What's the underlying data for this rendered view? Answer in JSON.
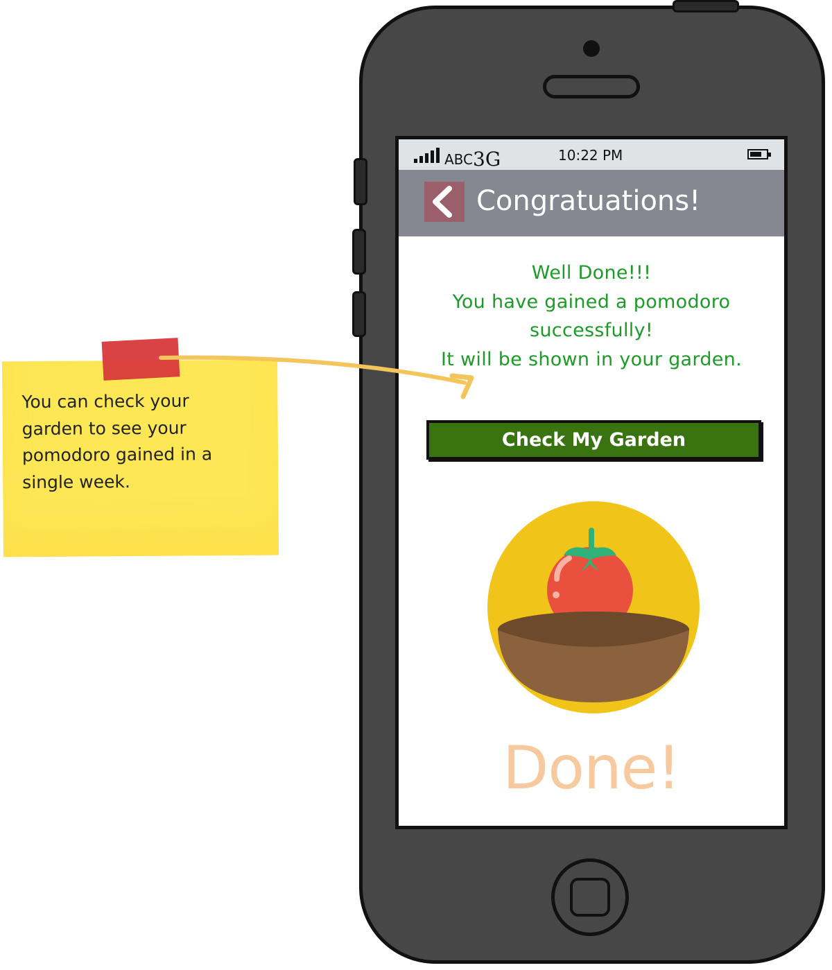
{
  "sticky_note": {
    "text": "You can check your\ngarden to see your\npomodoro gained in a\nsingle week."
  },
  "status_bar": {
    "carrier": "ABC",
    "network": "3G",
    "time": "10:22 PM"
  },
  "nav": {
    "title": "Congratuations!"
  },
  "message": {
    "line1": "Well Done!!!",
    "line2": "You have gained a pomodoro",
    "line3": "successfully!",
    "line4": "It will be shown in your garden."
  },
  "garden_button": {
    "label": "Check My Garden"
  },
  "done_label": "Done!",
  "colors": {
    "phone_body": "#474747",
    "nav_bar": "#868891",
    "back_button": "#9a5f6a",
    "message_text": "#1d9a28",
    "button_bg": "#3a7411",
    "done_text": "#f7c99e",
    "sticky_note": "#fde755",
    "tape": "#d8393b",
    "pomodoro_circle": "#f0c418",
    "tomato": "#e9503d",
    "soil": "#8b623d"
  }
}
